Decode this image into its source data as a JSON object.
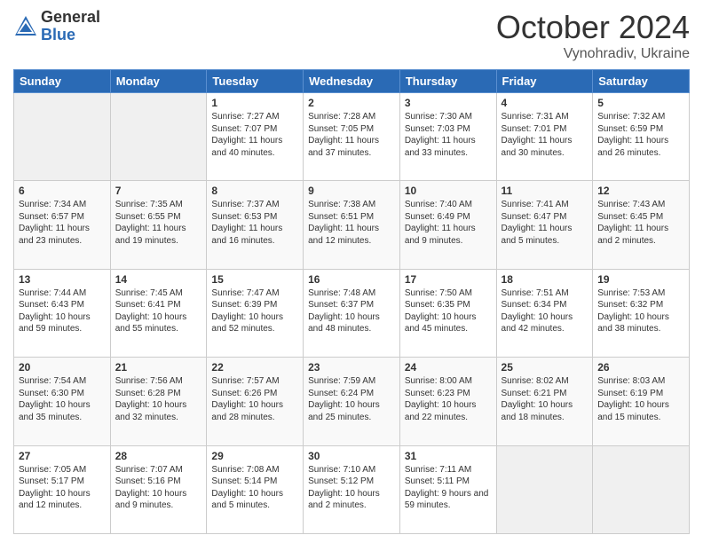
{
  "logo": {
    "general": "General",
    "blue": "Blue"
  },
  "header": {
    "month": "October 2024",
    "location": "Vynohradiv, Ukraine"
  },
  "weekdays": [
    "Sunday",
    "Monday",
    "Tuesday",
    "Wednesday",
    "Thursday",
    "Friday",
    "Saturday"
  ],
  "weeks": [
    [
      {
        "day": "",
        "empty": true
      },
      {
        "day": "",
        "empty": true
      },
      {
        "day": "1",
        "sunrise": "Sunrise: 7:27 AM",
        "sunset": "Sunset: 7:07 PM",
        "daylight": "Daylight: 11 hours and 40 minutes."
      },
      {
        "day": "2",
        "sunrise": "Sunrise: 7:28 AM",
        "sunset": "Sunset: 7:05 PM",
        "daylight": "Daylight: 11 hours and 37 minutes."
      },
      {
        "day": "3",
        "sunrise": "Sunrise: 7:30 AM",
        "sunset": "Sunset: 7:03 PM",
        "daylight": "Daylight: 11 hours and 33 minutes."
      },
      {
        "day": "4",
        "sunrise": "Sunrise: 7:31 AM",
        "sunset": "Sunset: 7:01 PM",
        "daylight": "Daylight: 11 hours and 30 minutes."
      },
      {
        "day": "5",
        "sunrise": "Sunrise: 7:32 AM",
        "sunset": "Sunset: 6:59 PM",
        "daylight": "Daylight: 11 hours and 26 minutes."
      }
    ],
    [
      {
        "day": "6",
        "sunrise": "Sunrise: 7:34 AM",
        "sunset": "Sunset: 6:57 PM",
        "daylight": "Daylight: 11 hours and 23 minutes."
      },
      {
        "day": "7",
        "sunrise": "Sunrise: 7:35 AM",
        "sunset": "Sunset: 6:55 PM",
        "daylight": "Daylight: 11 hours and 19 minutes."
      },
      {
        "day": "8",
        "sunrise": "Sunrise: 7:37 AM",
        "sunset": "Sunset: 6:53 PM",
        "daylight": "Daylight: 11 hours and 16 minutes."
      },
      {
        "day": "9",
        "sunrise": "Sunrise: 7:38 AM",
        "sunset": "Sunset: 6:51 PM",
        "daylight": "Daylight: 11 hours and 12 minutes."
      },
      {
        "day": "10",
        "sunrise": "Sunrise: 7:40 AM",
        "sunset": "Sunset: 6:49 PM",
        "daylight": "Daylight: 11 hours and 9 minutes."
      },
      {
        "day": "11",
        "sunrise": "Sunrise: 7:41 AM",
        "sunset": "Sunset: 6:47 PM",
        "daylight": "Daylight: 11 hours and 5 minutes."
      },
      {
        "day": "12",
        "sunrise": "Sunrise: 7:43 AM",
        "sunset": "Sunset: 6:45 PM",
        "daylight": "Daylight: 11 hours and 2 minutes."
      }
    ],
    [
      {
        "day": "13",
        "sunrise": "Sunrise: 7:44 AM",
        "sunset": "Sunset: 6:43 PM",
        "daylight": "Daylight: 10 hours and 59 minutes."
      },
      {
        "day": "14",
        "sunrise": "Sunrise: 7:45 AM",
        "sunset": "Sunset: 6:41 PM",
        "daylight": "Daylight: 10 hours and 55 minutes."
      },
      {
        "day": "15",
        "sunrise": "Sunrise: 7:47 AM",
        "sunset": "Sunset: 6:39 PM",
        "daylight": "Daylight: 10 hours and 52 minutes."
      },
      {
        "day": "16",
        "sunrise": "Sunrise: 7:48 AM",
        "sunset": "Sunset: 6:37 PM",
        "daylight": "Daylight: 10 hours and 48 minutes."
      },
      {
        "day": "17",
        "sunrise": "Sunrise: 7:50 AM",
        "sunset": "Sunset: 6:35 PM",
        "daylight": "Daylight: 10 hours and 45 minutes."
      },
      {
        "day": "18",
        "sunrise": "Sunrise: 7:51 AM",
        "sunset": "Sunset: 6:34 PM",
        "daylight": "Daylight: 10 hours and 42 minutes."
      },
      {
        "day": "19",
        "sunrise": "Sunrise: 7:53 AM",
        "sunset": "Sunset: 6:32 PM",
        "daylight": "Daylight: 10 hours and 38 minutes."
      }
    ],
    [
      {
        "day": "20",
        "sunrise": "Sunrise: 7:54 AM",
        "sunset": "Sunset: 6:30 PM",
        "daylight": "Daylight: 10 hours and 35 minutes."
      },
      {
        "day": "21",
        "sunrise": "Sunrise: 7:56 AM",
        "sunset": "Sunset: 6:28 PM",
        "daylight": "Daylight: 10 hours and 32 minutes."
      },
      {
        "day": "22",
        "sunrise": "Sunrise: 7:57 AM",
        "sunset": "Sunset: 6:26 PM",
        "daylight": "Daylight: 10 hours and 28 minutes."
      },
      {
        "day": "23",
        "sunrise": "Sunrise: 7:59 AM",
        "sunset": "Sunset: 6:24 PM",
        "daylight": "Daylight: 10 hours and 25 minutes."
      },
      {
        "day": "24",
        "sunrise": "Sunrise: 8:00 AM",
        "sunset": "Sunset: 6:23 PM",
        "daylight": "Daylight: 10 hours and 22 minutes."
      },
      {
        "day": "25",
        "sunrise": "Sunrise: 8:02 AM",
        "sunset": "Sunset: 6:21 PM",
        "daylight": "Daylight: 10 hours and 18 minutes."
      },
      {
        "day": "26",
        "sunrise": "Sunrise: 8:03 AM",
        "sunset": "Sunset: 6:19 PM",
        "daylight": "Daylight: 10 hours and 15 minutes."
      }
    ],
    [
      {
        "day": "27",
        "sunrise": "Sunrise: 7:05 AM",
        "sunset": "Sunset: 5:17 PM",
        "daylight": "Daylight: 10 hours and 12 minutes."
      },
      {
        "day": "28",
        "sunrise": "Sunrise: 7:07 AM",
        "sunset": "Sunset: 5:16 PM",
        "daylight": "Daylight: 10 hours and 9 minutes."
      },
      {
        "day": "29",
        "sunrise": "Sunrise: 7:08 AM",
        "sunset": "Sunset: 5:14 PM",
        "daylight": "Daylight: 10 hours and 5 minutes."
      },
      {
        "day": "30",
        "sunrise": "Sunrise: 7:10 AM",
        "sunset": "Sunset: 5:12 PM",
        "daylight": "Daylight: 10 hours and 2 minutes."
      },
      {
        "day": "31",
        "sunrise": "Sunrise: 7:11 AM",
        "sunset": "Sunset: 5:11 PM",
        "daylight": "Daylight: 9 hours and 59 minutes."
      },
      {
        "day": "",
        "empty": true
      },
      {
        "day": "",
        "empty": true
      }
    ]
  ]
}
